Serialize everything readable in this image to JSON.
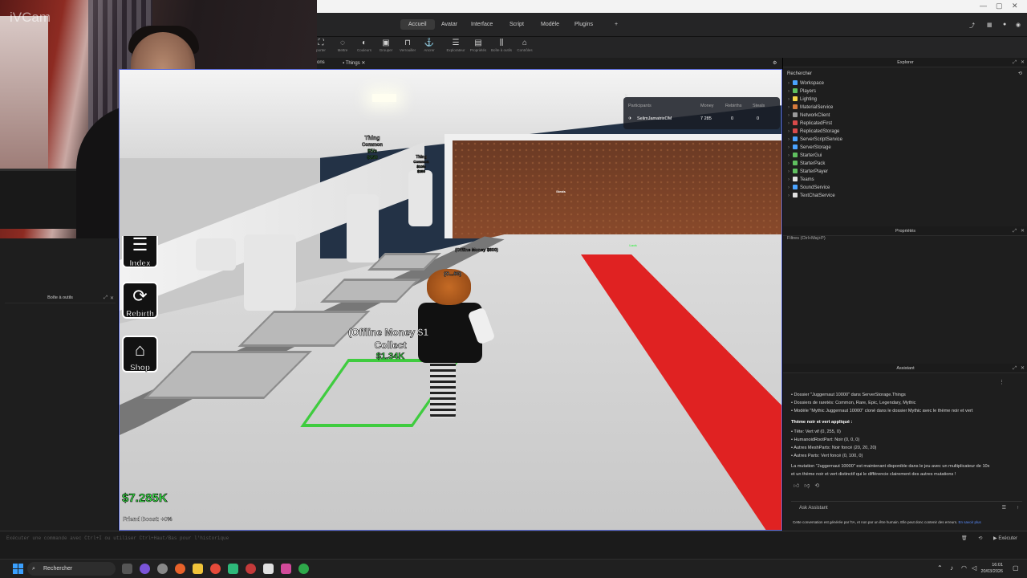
{
  "webcam": {
    "label": "iVCam"
  },
  "studio": {
    "menu_tabs": [
      "Accueil",
      "Avatar",
      "Interface",
      "Script",
      "Modèle",
      "Plugins"
    ],
    "active_tab": "Accueil",
    "tools": [
      "Mettre",
      "Couleurs",
      "Grouper",
      "Verrouiller",
      "Ancrer",
      "Explorateur",
      "Propriétés",
      "Boîte à outils",
      "Contrôles"
    ],
    "tools_left_label": "porter",
    "doc_tabs": [
      "ons",
      "Things"
    ],
    "toolbox_title": "Boîte à outils",
    "command_hint": "Exécuter une commande avec Ctrl+I ou utiliser Ctrl+Haut/Bas pour l'historique",
    "command_run": "Exécuter"
  },
  "explorer": {
    "title": "Explorer",
    "search": "Rechercher",
    "items": [
      {
        "label": "Workspace",
        "color": "#4aa3ff"
      },
      {
        "label": "Players",
        "color": "#5fbf5f"
      },
      {
        "label": "Lighting",
        "color": "#f5d547"
      },
      {
        "label": "MaterialService",
        "color": "#d67a3c"
      },
      {
        "label": "NetworkClient",
        "color": "#9a9a9a"
      },
      {
        "label": "ReplicatedFirst",
        "color": "#d84a4a"
      },
      {
        "label": "ReplicatedStorage",
        "color": "#d84a4a"
      },
      {
        "label": "ServerScriptService",
        "color": "#4aa3ff"
      },
      {
        "label": "ServerStorage",
        "color": "#4aa3ff"
      },
      {
        "label": "StarterGui",
        "color": "#5fbf5f"
      },
      {
        "label": "StarterPack",
        "color": "#5fbf5f"
      },
      {
        "label": "StarterPlayer",
        "color": "#5fbf5f"
      },
      {
        "label": "Teams",
        "color": "#e0e0e0"
      },
      {
        "label": "SoundService",
        "color": "#4aa3ff"
      },
      {
        "label": "TextChatService",
        "color": "#e0e0e0"
      }
    ]
  },
  "properties": {
    "title": "Propriétés",
    "filter": "Filtres (Ctrl+Maj+P)"
  },
  "assistant": {
    "title": "Assistant",
    "lines": [
      {
        "text": "• Dossier \"Juggernaut 10000\" dans ServerStorage.Things",
        "bold": false
      },
      {
        "text": "• Dossiers de raretés: Common, Rare, Epic, Legendary, Mythic",
        "bold": false
      },
      {
        "text": "• Modèle \"Mythic Juggernaut 10000\" cloné dans le dossier Mythic avec le thème noir et vert",
        "bold": false
      },
      {
        "text": "Thème noir et vert appliqué :",
        "bold": true
      },
      {
        "text": "• Tête: Vert vif (0, 255, 0)",
        "bold": false
      },
      {
        "text": "• HumanoidRootPart: Noir (0, 0, 0)",
        "bold": false
      },
      {
        "text": "• Autres MeshParts: Noir foncé (20, 20, 20)",
        "bold": false
      },
      {
        "text": "• Autres Parts: Vert foncé (0, 100, 0)",
        "bold": false
      },
      {
        "text": "La mutation \"Juggernaut 10000\" est maintenant disponible dans le jeu avec un multiplicateur de 10x",
        "bold": false
      },
      {
        "text": "et un thème noir et vert distinctif qui le différencie clairement des autres mutations !",
        "bold": false
      }
    ],
    "ask_placeholder": "Ask Assistant",
    "disclaimer": "Cette conversation est générée par l'IA, et non par un être humain. Elle peut donc contenir des erreurs.",
    "disclaimer_link": "En savoir plus"
  },
  "game": {
    "leaderboard": {
      "headers": [
        "Participants",
        "Money",
        "Rebirths",
        "Steals"
      ],
      "row": {
        "name": "SelimJamatrixOM",
        "money": "7 285",
        "rebirths": "0",
        "steals": "0"
      }
    },
    "thing1": {
      "name": "Thing",
      "rarity": "Common",
      "rate": "$5/s",
      "price": "$250"
    },
    "thing2": {
      "name": "Thing",
      "rarity": "Common",
      "rate": "$10/s",
      "price": "$250"
    },
    "offline_small": "(Offline Money $600)",
    "offline_mid": "(O...00)",
    "offline_big": "(Offline Money $1",
    "collect": "Collect",
    "collect_amount": "$1.34K",
    "wall_label": "Steals",
    "carpet_label": "Lock",
    "side_buttons": [
      {
        "label": "Index",
        "icon": "index-icon"
      },
      {
        "label": "Rebirth",
        "icon": "rebirth-icon"
      },
      {
        "label": "Shop",
        "icon": "shop-icon"
      }
    ],
    "cash": "$7.285K",
    "friend_boost": "Friend Boost: +0%"
  },
  "taskbar": {
    "search": "Rechercher",
    "time": "16:01",
    "date": "20/03/2026"
  }
}
